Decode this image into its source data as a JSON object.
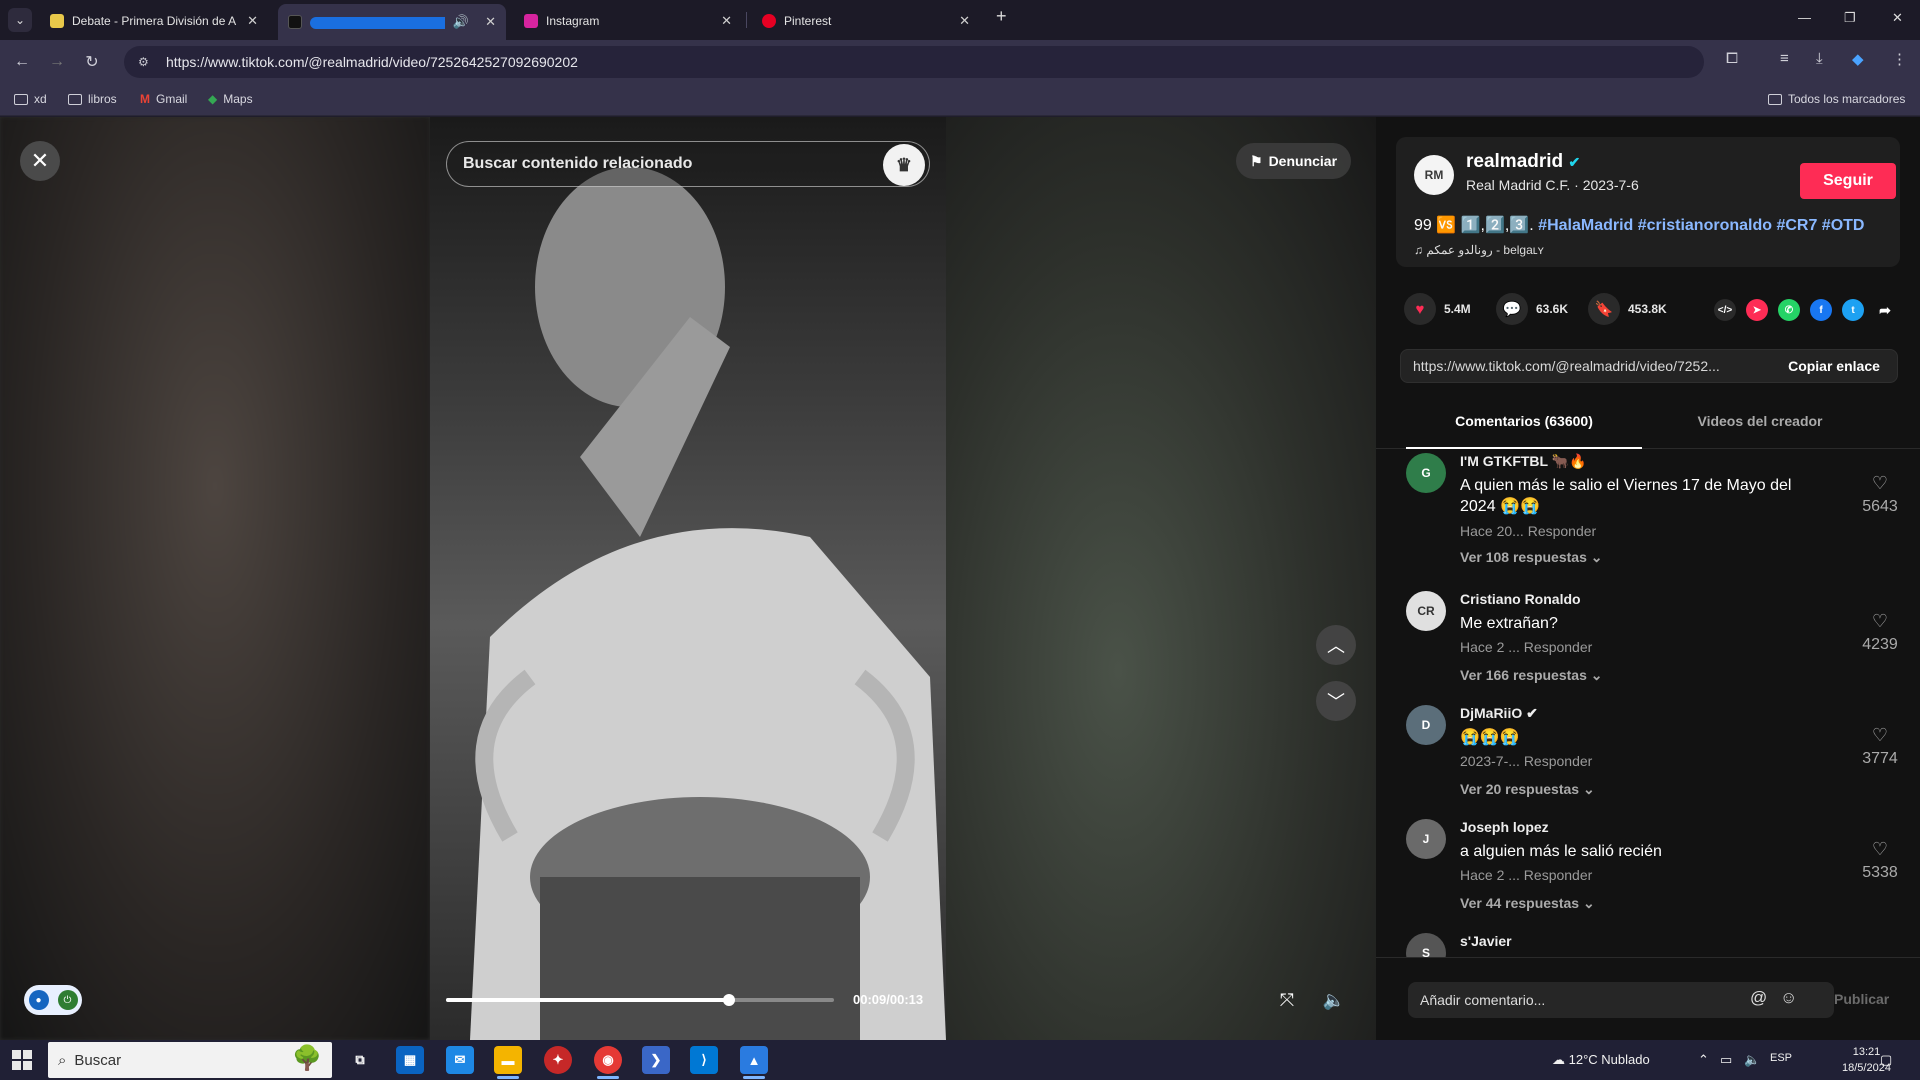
{
  "browser": {
    "tabs": [
      {
        "title": "Debate - Primera División de A",
        "color": "#e8c84a"
      },
      {
        "title": "",
        "color": "#111111"
      },
      {
        "title": "Instagram",
        "color": "#d6249f"
      },
      {
        "title": "Pinterest",
        "color": "#e60023"
      }
    ],
    "url": "https://www.tiktok.com/@realmadrid/video/7252642527092690202",
    "bookmarks": [
      "xd",
      "libros",
      "Gmail",
      "Maps"
    ],
    "all_bookmarks": "Todos los marcadores",
    "new_tab": "+",
    "win": {
      "min": "—",
      "max": "❐",
      "close": "✕"
    }
  },
  "player": {
    "search_placeholder": "Buscar contenido relacionado",
    "report_label": "Denunciar",
    "time": "00:09/00:13",
    "progress": 0.73,
    "close": "✕",
    "up": "︿",
    "down": "﹀"
  },
  "post": {
    "username": "realmadrid",
    "subtitle": "Real Madrid C.F. · 2023-7-6",
    "follow": "Seguir",
    "caption_prefix": "99 🆚 1️⃣,2️⃣,3️⃣.",
    "hashtags": "#HalaMadrid #cristianoronaldo #CR7 #OTD",
    "music": "رونالدو عمکم - belgaʟʏ",
    "likes": "5.4M",
    "comments": "63.6K",
    "saves": "453.8K",
    "share_link": "https://www.tiktok.com/@realmadrid/video/7252...",
    "copy_label": "Copiar enlace",
    "tab_comments": "Comentarios (63600)",
    "tab_videos": "Videos del creador"
  },
  "comments": [
    {
      "name": "I'M GTKFTBL 🐂🔥",
      "text": "A quien más le salio el Viernes 17 de Mayo del 2024 😭😭",
      "meta": "Hace 20...  Responder",
      "more": "Ver 108 respuestas ⌄",
      "likes": "5643",
      "avatar_color": "#2f7d4a"
    },
    {
      "name": "Cristiano Ronaldo",
      "text": "Me extrañan?",
      "meta": "Hace 2 ...  Responder",
      "more": "Ver 166 respuestas ⌄",
      "likes": "4239",
      "avatar_color": "#c9c9c9"
    },
    {
      "name": "DjMaRiiO ✔",
      "text": "😭😭😭",
      "meta": "2023-7-...  Responder",
      "more": "Ver 20 respuestas ⌄",
      "likes": "3774",
      "avatar_color": "#5b6e7a"
    },
    {
      "name": "Joseph lopez",
      "text": "a alguien más le salió recién",
      "meta": "Hace 2 ...  Responder",
      "more": "Ver 44 respuestas ⌄",
      "likes": "5338",
      "avatar_color": "#6a6a6a"
    },
    {
      "name": "s'Javier",
      "text": "",
      "meta": "",
      "more": "",
      "likes": "",
      "avatar_color": "#555555"
    }
  ],
  "comment_box": {
    "placeholder": "Añadir comentario...",
    "publish": "Publicar"
  },
  "taskbar": {
    "search": "Buscar",
    "weather": "12°C  Nublado",
    "lang": "ESP",
    "time": "13:21",
    "date": "18/5/2024"
  }
}
